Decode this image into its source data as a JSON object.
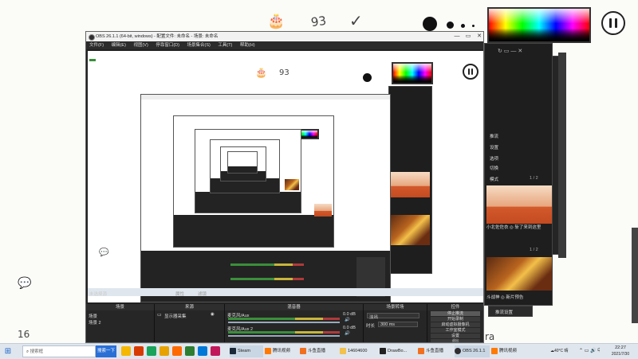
{
  "background": {
    "doodle_number_top": "93",
    "doodle_number_left": "16",
    "doodle_letters": "ra"
  },
  "obs": {
    "title": "OBS 26.1.1 (64-bit, windows) - 配置文件: 未命名 - 场景: 未命名",
    "menu": [
      "文件(F)",
      "编辑(E)",
      "视图(V)",
      "停靠窗口(D)",
      "场景集合(S)",
      "工具(T)",
      "帮助(H)"
    ],
    "status_label": "未选择源",
    "properties_label": "属性",
    "filters_label": "滤镜",
    "docks": {
      "scenes": {
        "title": "场景",
        "items": [
          "场景",
          "场景 2"
        ]
      },
      "sources": {
        "title": "来源",
        "items": [
          "显示器采集"
        ]
      },
      "mixer": {
        "title": "混音器",
        "channels": [
          {
            "name": "麦克风/Aux",
            "db": "0.0 dB"
          },
          {
            "name": "麦克风/Aux 2",
            "db": "0.0 dB"
          }
        ]
      },
      "transitions": {
        "title": "场景转场",
        "type": "淡出",
        "duration_label": "时长",
        "duration": "300 ms"
      },
      "controls": {
        "title": "控件",
        "buttons": [
          "停止推流",
          "开始录制",
          "启动虚拟摄像机",
          "工作室模式",
          "设置",
          "退出"
        ]
      }
    }
  },
  "right_panel": {
    "page_indicator_top": "1 / 2",
    "page_indicator_bottom": "1 / 2",
    "caption": "小北佐佐衣 ◎ 斩了来到这里",
    "caption_2": "斗战神 ◎ 新片预告",
    "menu_items": [
      "推流",
      "设置",
      "选项",
      "切换",
      "模式",
      "全屏",
      "退出"
    ],
    "footer_button": "推流设置"
  },
  "taskbar": {
    "search_placeholder": "搜索框",
    "items": [
      {
        "label": "搜索一下",
        "color": "#2a6fd6"
      },
      {
        "label": "Steam",
        "color": "#1b2838"
      },
      {
        "label": "腾讯视频",
        "color": "#ff7a00"
      },
      {
        "label": "斗鱼直播",
        "color": "#f07020"
      },
      {
        "label": "14604600",
        "color": "#444444"
      },
      {
        "label": "DrawBo...",
        "color": "#222222"
      },
      {
        "label": "斗鱼直播",
        "color": "#f07020"
      },
      {
        "label": "OBS 26.1.1",
        "color": "#302e31"
      },
      {
        "label": "腾讯视频",
        "color": "#ff7a00"
      }
    ],
    "weather": "40°C 晴",
    "time": "22:27",
    "date": "2021/7/30",
    "ime": "中"
  },
  "colors": {
    "obs_dark": "#222222",
    "taskbar": "#dfe6ee",
    "accent_blue": "#2a6fd6"
  }
}
